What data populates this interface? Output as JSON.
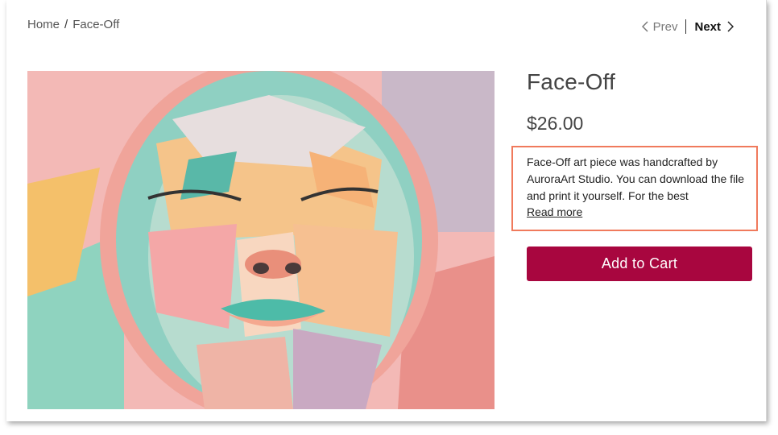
{
  "breadcrumb": {
    "home": "Home",
    "separator": "/",
    "current": "Face-Off"
  },
  "pager": {
    "prev": "Prev",
    "next": "Next"
  },
  "product": {
    "title": "Face-Off",
    "price": "$26.00",
    "description": "Face-Off art piece was handcrafted by AuroraArt Studio. You can download the file and print it yourself. For the best",
    "read_more": "Read more",
    "add_to_cart": "Add to Cart"
  },
  "colors": {
    "accent_button": "#a8063f",
    "highlight_border": "#f07a5c"
  },
  "icons": {
    "prev": "chevron-left-icon",
    "next": "chevron-right-icon"
  }
}
